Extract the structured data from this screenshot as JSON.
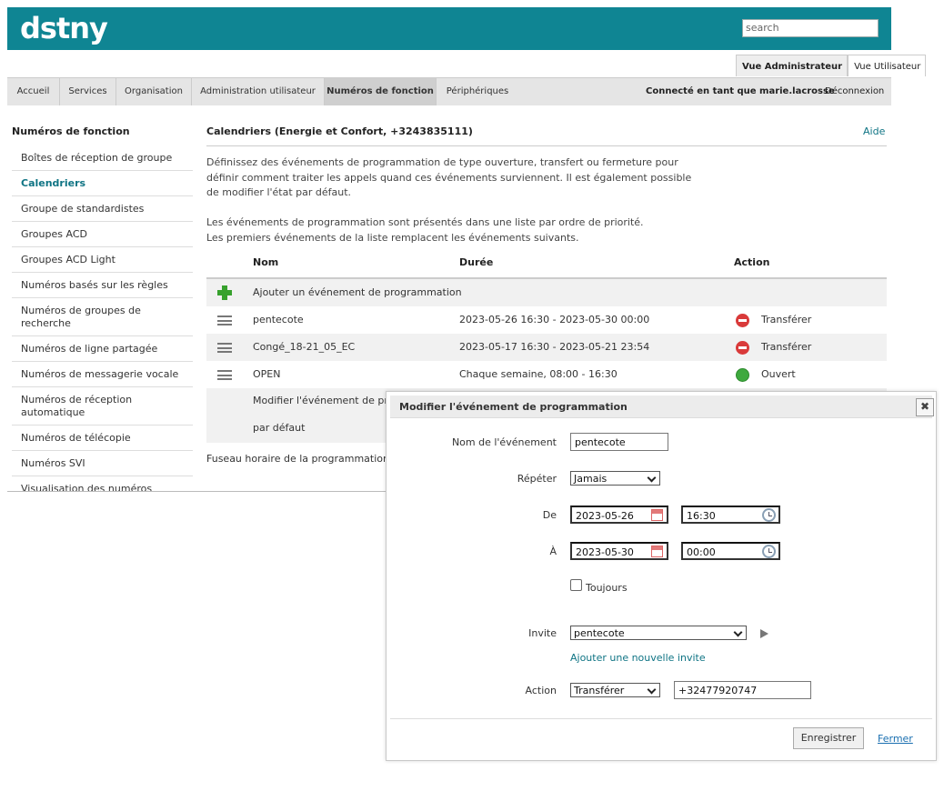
{
  "header": {
    "logo": "dstny",
    "search_placeholder": "search"
  },
  "view_tabs": [
    "Vue Administrateur",
    "Vue Utilisateur"
  ],
  "nav": {
    "items": [
      "Accueil",
      "Services",
      "Organisation",
      "Administration utilisateur",
      "Numéros de fonction",
      "Périphériques"
    ],
    "active": "Numéros de fonction",
    "connected_as": "Connecté en tant que marie.lacrosse",
    "logout": "Déconnexion"
  },
  "sidebar": {
    "title": "Numéros de fonction",
    "items": [
      "Boîtes de réception de groupe",
      "Calendriers",
      "Groupe de standardistes",
      "Groupes ACD",
      "Groupes ACD Light",
      "Numéros basés sur les règles",
      "Numéros de groupes de recherche",
      "Numéros de ligne partagée",
      "Numéros de messagerie vocale",
      "Numéros de réception automatique",
      "Numéros de télécopie",
      "Numéros SVI",
      "Visualisation des numéros"
    ],
    "active": "Calendriers"
  },
  "main": {
    "title": "Calendriers (Energie et Confort, +3243835111)",
    "help": "Aide",
    "para1": "Définissez des événements de programmation de type ouverture, transfert ou fermeture pour définir comment traiter les appels quand ces événements surviennent. Il est également possible de modifier l'état par défaut.",
    "para2": "Les événements de programmation sont présentés dans une liste par ordre de priorité. Les premiers événements de la liste remplacent les événements suivants.",
    "table": {
      "headers": {
        "name": "Nom",
        "duration": "Durée",
        "action": "Action"
      },
      "add_label": "Ajouter un événement de programmation",
      "rows": [
        {
          "name": "pentecote",
          "duration": "2023-05-26 16:30 - 2023-05-30 00:00",
          "action": "Transférer",
          "status_icon": "stop-icon"
        },
        {
          "name": "Congé_18-21_05_EC",
          "duration": "2023-05-17 16:30 - 2023-05-21 23:54",
          "action": "Transférer",
          "status_icon": "stop-icon"
        },
        {
          "name": "OPEN",
          "duration": "Chaque semaine, 08:00 - 16:30",
          "action": "Ouvert",
          "status_icon": "ok-icon"
        }
      ],
      "modify_default_1": "Modifier l'événement de pro",
      "modify_default_2": "par défaut"
    },
    "timezone": "Fuseau horaire de la programmation :"
  },
  "dialog": {
    "title": "Modifier l'événement de programmation",
    "close_symbol": "✖",
    "event_name_label": "Nom de l'événement",
    "event_name_value": "pentecote",
    "repeat_label": "Répéter",
    "repeat_value": "Jamais",
    "from_label": "De",
    "from_date": "2023-05-26",
    "from_time": "16:30",
    "to_label": "À",
    "to_date": "2023-05-30",
    "to_time": "00:00",
    "always_label": "Toujours",
    "prompt_label": "Invite",
    "prompt_value": "pentecote",
    "add_prompt": "Ajouter une nouvelle invite",
    "action_label": "Action",
    "action_value": "Transférer",
    "action_number": "+32477920747",
    "save": "Enregistrer",
    "close": "Fermer"
  },
  "colors": {
    "brand": "#0f8593",
    "link": "#0f7484",
    "stop": "#d93a3a",
    "ok": "#3ea93e"
  }
}
